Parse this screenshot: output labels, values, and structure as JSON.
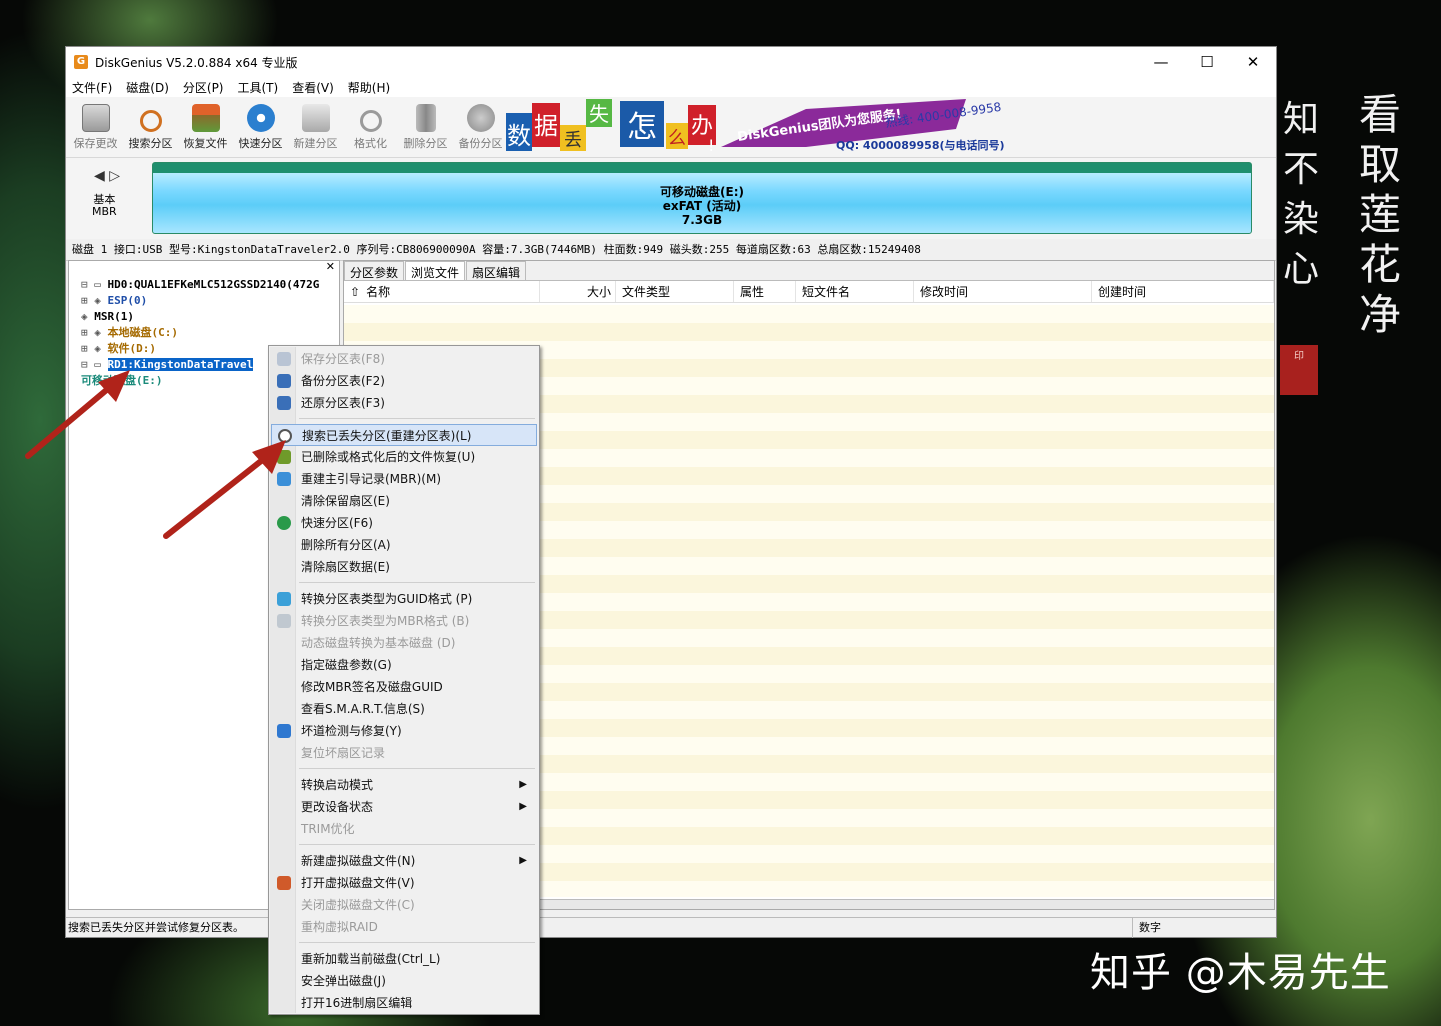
{
  "window": {
    "title": "DiskGenius V5.2.0.884 x64 专业版",
    "controls": {
      "minimize": "—",
      "maximize": "☐",
      "close": "✕"
    }
  },
  "menubar": [
    "文件(F)",
    "磁盘(D)",
    "分区(P)",
    "工具(T)",
    "查看(V)",
    "帮助(H)"
  ],
  "toolbar": [
    {
      "label": "保存更改",
      "icon": "save-icon",
      "enabled": false
    },
    {
      "label": "搜索分区",
      "icon": "search-icon",
      "enabled": true
    },
    {
      "label": "恢复文件",
      "icon": "recover-icon",
      "enabled": true
    },
    {
      "label": "快速分区",
      "icon": "quick-partition-icon",
      "enabled": true
    },
    {
      "label": "新建分区",
      "icon": "new-partition-icon",
      "enabled": false
    },
    {
      "label": "格式化",
      "icon": "format-icon",
      "enabled": false
    },
    {
      "label": "删除分区",
      "icon": "delete-icon",
      "enabled": false
    },
    {
      "label": "备份分区",
      "icon": "backup-icon",
      "enabled": false
    }
  ],
  "banner": {
    "chars": [
      "数",
      "据",
      "丢",
      "失",
      "怎",
      "么",
      "办",
      "!"
    ],
    "slogan": "DiskGenius团队为您服务!",
    "phone": "热线: 400-008-9958",
    "qq": "QQ: 4000089958(与电话同号)"
  },
  "disk_panel": {
    "type_line1": "基本",
    "type_line2": "MBR",
    "partition_name": "可移动磁盘(E:)",
    "partition_fs": "exFAT (活动)",
    "partition_size": "7.3GB"
  },
  "info_bar": "磁盘 1 接口:USB  型号:KingstonDataTraveler2.0  序列号:CB806900090A  容量:7.3GB(7446MB)  柱面数:949  磁头数:255  每道扇区数:63  总扇区数:15249408",
  "tree": [
    {
      "text": "HD0:QUAL1EFKeMLC512GSSD2140(472G",
      "selected": false,
      "color": "#000000"
    },
    {
      "text": "ESP(0)",
      "selected": false,
      "color": "#1f4ea8"
    },
    {
      "text": "MSR(1)",
      "selected": false,
      "color": "#000000"
    },
    {
      "text": "本地磁盘(C:)",
      "selected": false,
      "color": "#a56a00"
    },
    {
      "text": "软件(D:)",
      "selected": false,
      "color": "#a56a00"
    },
    {
      "text": "RD1:KingstonDataTravel",
      "selected": true,
      "color": "#ffffff"
    },
    {
      "text": "可移动磁盘(E:)",
      "selected": false,
      "color": "#1a8a7a"
    }
  ],
  "tabs": [
    "分区参数",
    "浏览文件",
    "扇区编辑"
  ],
  "active_tab": "浏览文件",
  "columns": [
    "名称",
    "大小",
    "文件类型",
    "属性",
    "短文件名",
    "修改时间",
    "创建时间"
  ],
  "status": {
    "text": "搜索已丢失分区并尝试修复分区表。",
    "num": "数字"
  },
  "context_menu": [
    {
      "label": "保存分区表(F8)",
      "enabled": false,
      "icon": "save-icon"
    },
    {
      "label": "备份分区表(F2)",
      "enabled": true,
      "icon": "backup-table-icon"
    },
    {
      "label": "还原分区表(F3)",
      "enabled": true,
      "icon": "restore-table-icon"
    },
    {
      "sep": true
    },
    {
      "label": "搜索已丢失分区(重建分区表)(L)",
      "enabled": true,
      "icon": "search-icon",
      "highlight": true
    },
    {
      "label": "已删除或格式化后的文件恢复(U)",
      "enabled": true,
      "icon": "recover-icon"
    },
    {
      "label": "重建主引导记录(MBR)(M)",
      "enabled": true,
      "icon": "edit-icon"
    },
    {
      "label": "清除保留扇区(E)",
      "enabled": true
    },
    {
      "label": "快速分区(F6)",
      "enabled": true,
      "icon": "clock-icon"
    },
    {
      "label": "删除所有分区(A)",
      "enabled": true
    },
    {
      "label": "清除扇区数据(E)",
      "enabled": true
    },
    {
      "sep": true
    },
    {
      "label": "转换分区表类型为GUID格式 (P)",
      "enabled": true,
      "icon": "convert-icon"
    },
    {
      "label": "转换分区表类型为MBR格式 (B)",
      "enabled": false,
      "icon": "convert-mbr-icon"
    },
    {
      "label": "动态磁盘转换为基本磁盘 (D)",
      "enabled": false
    },
    {
      "label": "指定磁盘参数(G)",
      "enabled": true
    },
    {
      "label": "修改MBR签名及磁盘GUID",
      "enabled": true
    },
    {
      "label": "查看S.M.A.R.T.信息(S)",
      "enabled": true
    },
    {
      "label": "坏道检测与修复(Y)",
      "enabled": true,
      "icon": "tools-icon"
    },
    {
      "label": "复位坏扇区记录",
      "enabled": false
    },
    {
      "sep": true
    },
    {
      "label": "转换启动模式",
      "enabled": true,
      "submenu": true
    },
    {
      "label": "更改设备状态",
      "enabled": true,
      "submenu": true
    },
    {
      "label": "TRIM优化",
      "enabled": false
    },
    {
      "sep": true
    },
    {
      "label": "新建虚拟磁盘文件(N)",
      "enabled": true,
      "submenu": true
    },
    {
      "label": "打开虚拟磁盘文件(V)",
      "enabled": true,
      "icon": "vdisk-icon"
    },
    {
      "label": "关闭虚拟磁盘文件(C)",
      "enabled": false
    },
    {
      "label": "重构虚拟RAID",
      "enabled": false
    },
    {
      "sep": true
    },
    {
      "label": "重新加载当前磁盘(Ctrl_L)",
      "enabled": true
    },
    {
      "label": "安全弹出磁盘(J)",
      "enabled": true
    },
    {
      "label": "打开16进制扇区编辑",
      "enabled": true
    }
  ],
  "calligraphy": {
    "col1": "看取莲花净",
    "col2": "知不染心",
    "seal": "印"
  },
  "watermark": "知乎 @木易先生",
  "colors": {
    "highlight": "#d7e5f8",
    "partition_teal": "#1f8f6e",
    "arrow": "#b0231a",
    "tree_select": "#0a64c8"
  }
}
